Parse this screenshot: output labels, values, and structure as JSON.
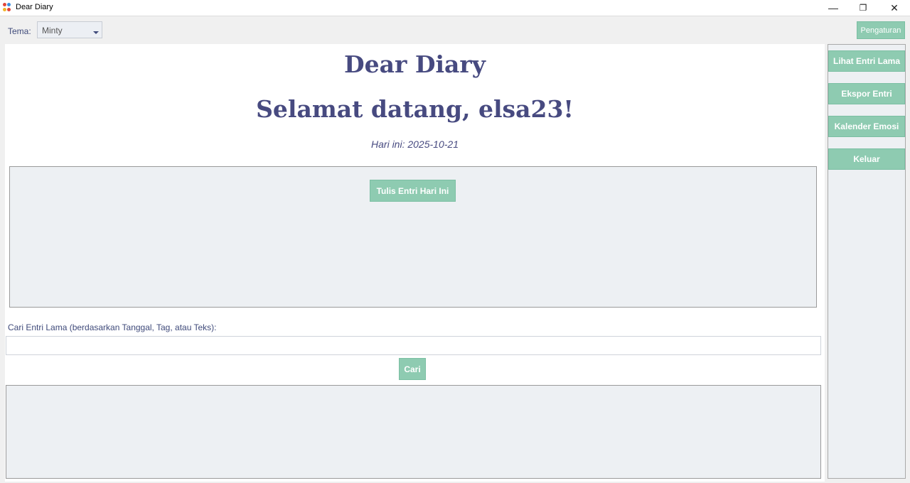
{
  "window": {
    "title": "Dear Diary",
    "minimize_glyph": "—",
    "restore_glyph": "❐",
    "close_glyph": "✕"
  },
  "toolbar": {
    "theme_label": "Tema:",
    "theme_value": "Minty",
    "settings_label": "Pengaturan"
  },
  "main": {
    "app_title": "Dear Diary",
    "welcome": "Selamat datang, elsa23!",
    "today_text": "Hari ini: 2025-10-21",
    "write_entry_label": "Tulis Entri Hari Ini",
    "search_label": "Cari Entri Lama (berdasarkan Tanggal, Tag, atau Teks):",
    "search_value": "",
    "search_button_label": "Cari"
  },
  "sidebar": {
    "items": [
      {
        "label": "Lihat Entri Lama"
      },
      {
        "label": "Ekspor Entri"
      },
      {
        "label": "Kalender Emosi"
      },
      {
        "label": "Keluar"
      }
    ]
  },
  "colors": {
    "accent": "#8ecbb1",
    "heading": "#474a80",
    "panel": "#edf0f3"
  },
  "icons": {
    "app": "color-dots-icon",
    "dropdown": "chevron-down-icon"
  }
}
